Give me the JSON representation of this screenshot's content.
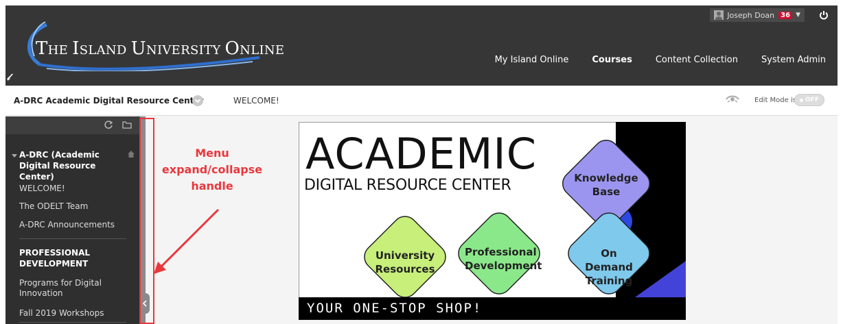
{
  "header": {
    "logo_text_parts": [
      "T",
      "HE ",
      "I",
      "SLAND ",
      "U",
      "NIVERSITY ",
      "O",
      "NLINE"
    ],
    "user_name": "Joseph Doan",
    "notification_count": "36",
    "nav": [
      {
        "label": "My Island Online",
        "active": false
      },
      {
        "label": "Courses",
        "active": true
      },
      {
        "label": "Content Collection",
        "active": false
      },
      {
        "label": "System Admin",
        "active": false
      }
    ]
  },
  "breadcrumb": {
    "course": "A-DRC Academic Digital Resource Center",
    "page": "WELCOME!",
    "edit_mode_label": "Edit Mode is:",
    "edit_mode_value": "OFF"
  },
  "sidebar": {
    "title": "A-DRC (Academic Digital Resource Center)",
    "links": [
      "WELCOME!",
      "The ODELT Team",
      "A-DRC Announcements"
    ],
    "heading": "PROFESSIONAL DEVELOPMENT",
    "links2": [
      "Programs for Digital Innovation",
      "Fall 2019 Workshops"
    ]
  },
  "annotation": {
    "text": "Menu expand/collapse handle",
    "color": "#e8383d"
  },
  "banner": {
    "title": "ACADEMIC",
    "subtitle": "DIGITAL RESOURCE CENTER",
    "diamonds": [
      {
        "label": "Knowledge Base",
        "color": "#9b95ef"
      },
      {
        "label": "University Resources",
        "color": "#c7ef7a"
      },
      {
        "label": "Professional Development",
        "color": "#8be88a"
      },
      {
        "label": "On Demand Training",
        "color": "#7ec9ec"
      }
    ],
    "footer": "YOUR ONE-STOP SHOP!"
  },
  "colors": {
    "header_bg": "#363636",
    "sidebar_bg": "#2f2f2f",
    "badge": "#c8102e",
    "center_circle": "#2b48e0"
  }
}
